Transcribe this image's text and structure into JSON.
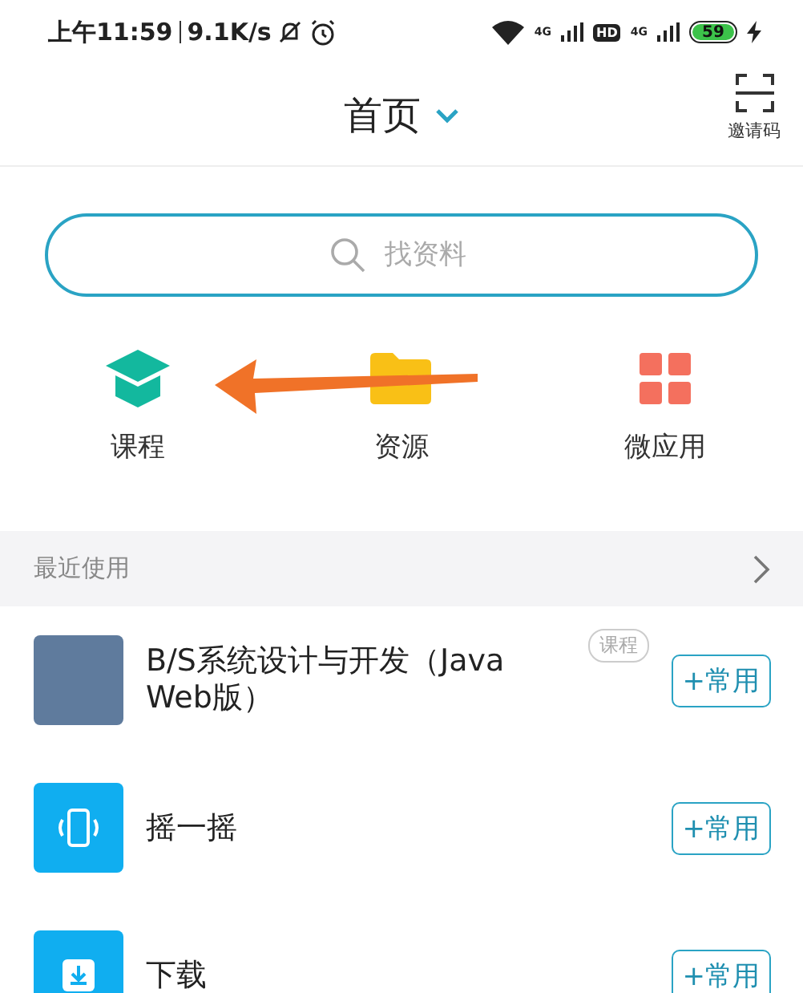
{
  "status_bar": {
    "time": "上午11:59",
    "speed": "9.1K/s",
    "network_labels": [
      "4G",
      "HD",
      "4G"
    ],
    "battery": "59"
  },
  "header": {
    "title": "首页",
    "scan_label": "邀请码"
  },
  "search": {
    "placeholder": "找资料"
  },
  "shortcuts": [
    {
      "label": "课程",
      "kind": "course"
    },
    {
      "label": "资源",
      "kind": "folder"
    },
    {
      "label": "微应用",
      "kind": "apps"
    }
  ],
  "recent": {
    "title": "最近使用",
    "items": [
      {
        "title": "B/S系统设计与开发（Java Web版）",
        "tag": "课程",
        "kind": "course",
        "button": "+常用"
      },
      {
        "title": "摇一摇",
        "kind": "shake",
        "button": "+常用"
      },
      {
        "title": "下载",
        "kind": "download",
        "button": "+常用"
      }
    ]
  }
}
